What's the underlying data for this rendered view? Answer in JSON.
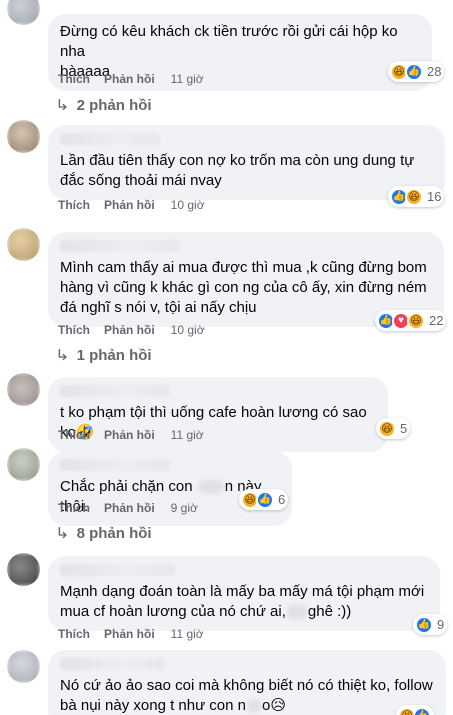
{
  "labels": {
    "like": "Thích",
    "reply": "Phản hồi"
  },
  "comments": [
    {
      "text": "Đừng có kêu khách ck tiền trước rồi gửi cái hộp ko nha\nbàaaaa",
      "time": "11 giờ",
      "reactions": [
        "haha-icon",
        "like-icon"
      ],
      "reaction_count": "28",
      "replies": "2 phản hồi"
    },
    {
      "text": "Lần đầu tiên thấy con nợ ko trốn ma còn ung dung tự\nđắc sống thoải mái nvay",
      "time": "10 giờ",
      "reactions": [
        "like-icon",
        "haha-icon"
      ],
      "reaction_count": "16"
    },
    {
      "text": "Mình cam thấy ai mua được thì mua ,k cũng đừng bom\nhàng vì cũng k khác gì con ng của cô ấy, xin đừng ném\nđá nghĩ s nói v, tội ai nấy chịu",
      "time": "10 giờ",
      "reactions": [
        "like-icon",
        "love-icon",
        "haha-icon"
      ],
      "reaction_count": "22",
      "replies": "1 phản hồi"
    },
    {
      "text": "t ko phạm tội thì uống cafe hoàn lương có sao ko🤣",
      "time": "11 giờ",
      "reactions": [
        "haha-icon"
      ],
      "reaction_count": "5"
    },
    {
      "text_a": "Chắc phải chặn con ",
      "text_b": "n này thôi.",
      "time": "9 giờ",
      "reactions": [
        "haha-icon",
        "like-icon"
      ],
      "reaction_count": "6",
      "replies": "8 phản hồi"
    },
    {
      "text_a": "Mạnh dạng đoán toàn là mấy ba mấy má tội phạm mới\nmua cf hoàn lương của nó chứ ai,",
      "text_b": "ghê :))",
      "time": "11 giờ",
      "reactions": [
        "like-icon"
      ],
      "reaction_count": "9"
    },
    {
      "text_a": "Nó cứ ảo ảo sao coi mà không biết nó có thiệt ko, follow\nbà nụi này xong t như con n",
      "text_b": "o😥"
    }
  ]
}
